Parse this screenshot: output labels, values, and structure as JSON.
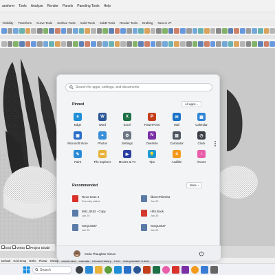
{
  "rhino": {
    "menu": [
      "ansform",
      "Tools",
      "Analyze",
      "Render",
      "Panels",
      "Paneling Tools",
      "Help"
    ],
    "tabs": [
      "Visibility",
      "Transform",
      "Curve Tools",
      "Surface Tools",
      "Solid Tools",
      "SubD Tools",
      "Render Tools",
      "Drafting",
      "New in V7"
    ],
    "osnap": {
      "end": "End",
      "vertex": "Vertex",
      "project": "Project",
      "disable": "Disabl"
    },
    "status": [
      "Default",
      "Grid Snap",
      "Ortho",
      "Planar",
      "Osnap",
      "SmartTrack",
      "Gumball",
      "Record History",
      "Filter",
      "Using Mouse Frame"
    ]
  },
  "start_menu": {
    "search_placeholder": "Search for apps, settings, and documents",
    "pinned_title": "Pinned",
    "all_apps_label": "All apps",
    "pinned": [
      {
        "label": "Edge",
        "icon": "edge-icon",
        "color": "#1e8fd6",
        "glyph": "e"
      },
      {
        "label": "Word",
        "icon": "word-icon",
        "color": "#2b5797",
        "glyph": "W"
      },
      {
        "label": "Excel",
        "icon": "excel-icon",
        "color": "#1e7145",
        "glyph": "X"
      },
      {
        "label": "PowerPoint",
        "icon": "powerpoint-icon",
        "color": "#c43e1c",
        "glyph": "P"
      },
      {
        "label": "Mail",
        "icon": "mail-icon",
        "color": "#1a73c7",
        "glyph": "✉"
      },
      {
        "label": "Calendar",
        "icon": "calendar-icon",
        "color": "#2f84d6",
        "glyph": "▦"
      },
      {
        "label": "Microsoft Store",
        "icon": "store-icon",
        "color": "#2a6fc9",
        "glyph": "▣"
      },
      {
        "label": "Photos",
        "icon": "photos-icon",
        "color": "#3a8fd8",
        "glyph": "▲"
      },
      {
        "label": "Settings",
        "icon": "settings-icon",
        "color": "#6d7682",
        "glyph": "⚙"
      },
      {
        "label": "OneNote",
        "icon": "onenote-icon",
        "color": "#7b2fa5",
        "glyph": "N"
      },
      {
        "label": "Calculator",
        "icon": "calculator-icon",
        "color": "#4f5660",
        "glyph": "▤"
      },
      {
        "label": "Clock",
        "icon": "clock-icon",
        "color": "#3b3f46",
        "glyph": "◷"
      },
      {
        "label": "Paint",
        "icon": "paint-icon",
        "color": "#2a8ad6",
        "glyph": "✎"
      },
      {
        "label": "File Explorer",
        "icon": "file-explorer-icon",
        "color": "#e8b33a",
        "glyph": "▬"
      },
      {
        "label": "Movies & TV",
        "icon": "movies-tv-icon",
        "color": "#2b3fa0",
        "glyph": "▶"
      },
      {
        "label": "Tips",
        "icon": "tips-icon",
        "color": "#1d9ad6",
        "glyph": "💡"
      },
      {
        "label": "Audible",
        "icon": "audible-icon",
        "color": "#f39a1c",
        "glyph": "a"
      },
      {
        "label": "iTunes",
        "icon": "itunes-icon",
        "color": "#e95ea8",
        "glyph": "♪"
      }
    ],
    "recommended_title": "Recommended",
    "more_label": "More",
    "recommended": [
      {
        "name": "Revo Scan 4",
        "sub": "Recently added",
        "icon": "revo-scan-icon",
        "color": "#d9322b"
      },
      {
        "name": "libeeePitinCba",
        "sub": "Jan 25",
        "icon": "document-icon",
        "color": "#5a7aa8"
      },
      {
        "name": "IMG_0452 - Copy",
        "sub": "Jan 25",
        "icon": "image-file-icon",
        "color": "#5a7aa8"
      },
      {
        "name": "Hifa Book",
        "sub": "Jan 25",
        "icon": "pdf-icon",
        "color": "#d23a2f"
      },
      {
        "name": "SGQL5037",
        "sub": "Jan 25",
        "icon": "document-icon",
        "color": "#5a7aa8"
      },
      {
        "name": "SGQL5037",
        "sub": "Jan 25",
        "icon": "document-icon",
        "color": "#5a7aa8"
      }
    ],
    "user_name": "Carla Thaughter Simon"
  },
  "taskbar": {
    "search_label": "Search"
  }
}
